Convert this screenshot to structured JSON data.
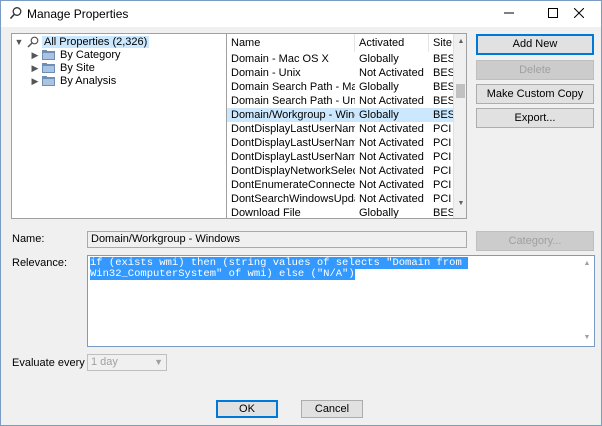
{
  "window": {
    "title": "Manage Properties"
  },
  "tree": {
    "items": [
      {
        "label": "All Properties (2,326)",
        "expanded": true,
        "selected": true
      },
      {
        "label": "By Category"
      },
      {
        "label": "By Site"
      },
      {
        "label": "By Analysis"
      }
    ]
  },
  "list": {
    "columns": [
      "Name",
      "Activated",
      "Site"
    ],
    "rows": [
      {
        "name": "Domain - Mac OS X",
        "activated": "Globally",
        "site": "BES Ir"
      },
      {
        "name": "Domain - Unix",
        "activated": "Not Activated",
        "site": "BES Ir"
      },
      {
        "name": "Domain Search Path - Mac O...",
        "activated": "Globally",
        "site": "BES Ir"
      },
      {
        "name": "Domain Search Path - Unix",
        "activated": "Not Activated",
        "site": "BES Ir"
      },
      {
        "name": "Domain/Workgroup - Windo...",
        "activated": "Globally",
        "site": "BES Ir",
        "selected": true
      },
      {
        "name": "DontDisplayLastUserName",
        "activated": "Not Activated",
        "site": "PCI D"
      },
      {
        "name": "DontDisplayLastUserName",
        "activated": "Not Activated",
        "site": "PCI D"
      },
      {
        "name": "DontDisplayLastUserName",
        "activated": "Not Activated",
        "site": "PCI D"
      },
      {
        "name": "DontDisplayNetworkSelectio...",
        "activated": "Not Activated",
        "site": "PCI D"
      },
      {
        "name": "DontEnumerateConnectedUs...",
        "activated": "Not Activated",
        "site": "PCI D"
      },
      {
        "name": "DontSearchWindowsUpdate",
        "activated": "Not Activated",
        "site": "PCI D"
      },
      {
        "name": "Download File",
        "activated": "Globally",
        "site": "BES Ir"
      }
    ]
  },
  "buttons": {
    "add_new": "Add New",
    "delete": "Delete",
    "make_custom_copy": "Make Custom Copy",
    "export": "Export...",
    "category": "Category...",
    "ok": "OK",
    "cancel": "Cancel"
  },
  "form": {
    "name_label": "Name:",
    "name_value": "Domain/Workgroup - Windows",
    "relevance_label": "Relevance:",
    "relevance_value": "if (exists wmi) then (string values of selects \"Domain from Win32_ComputerSystem\" of wmi) else (\"N/A\")",
    "evaluate_label": "Evaluate every",
    "evaluate_value": "1 day"
  },
  "colors": {
    "selection": "#cce8ff",
    "text_highlight": "#3399ff",
    "accent": "#0078d7"
  },
  "icons": [
    "search-icon",
    "folder-icon",
    "minimize-icon",
    "maximize-icon",
    "close-icon"
  ]
}
